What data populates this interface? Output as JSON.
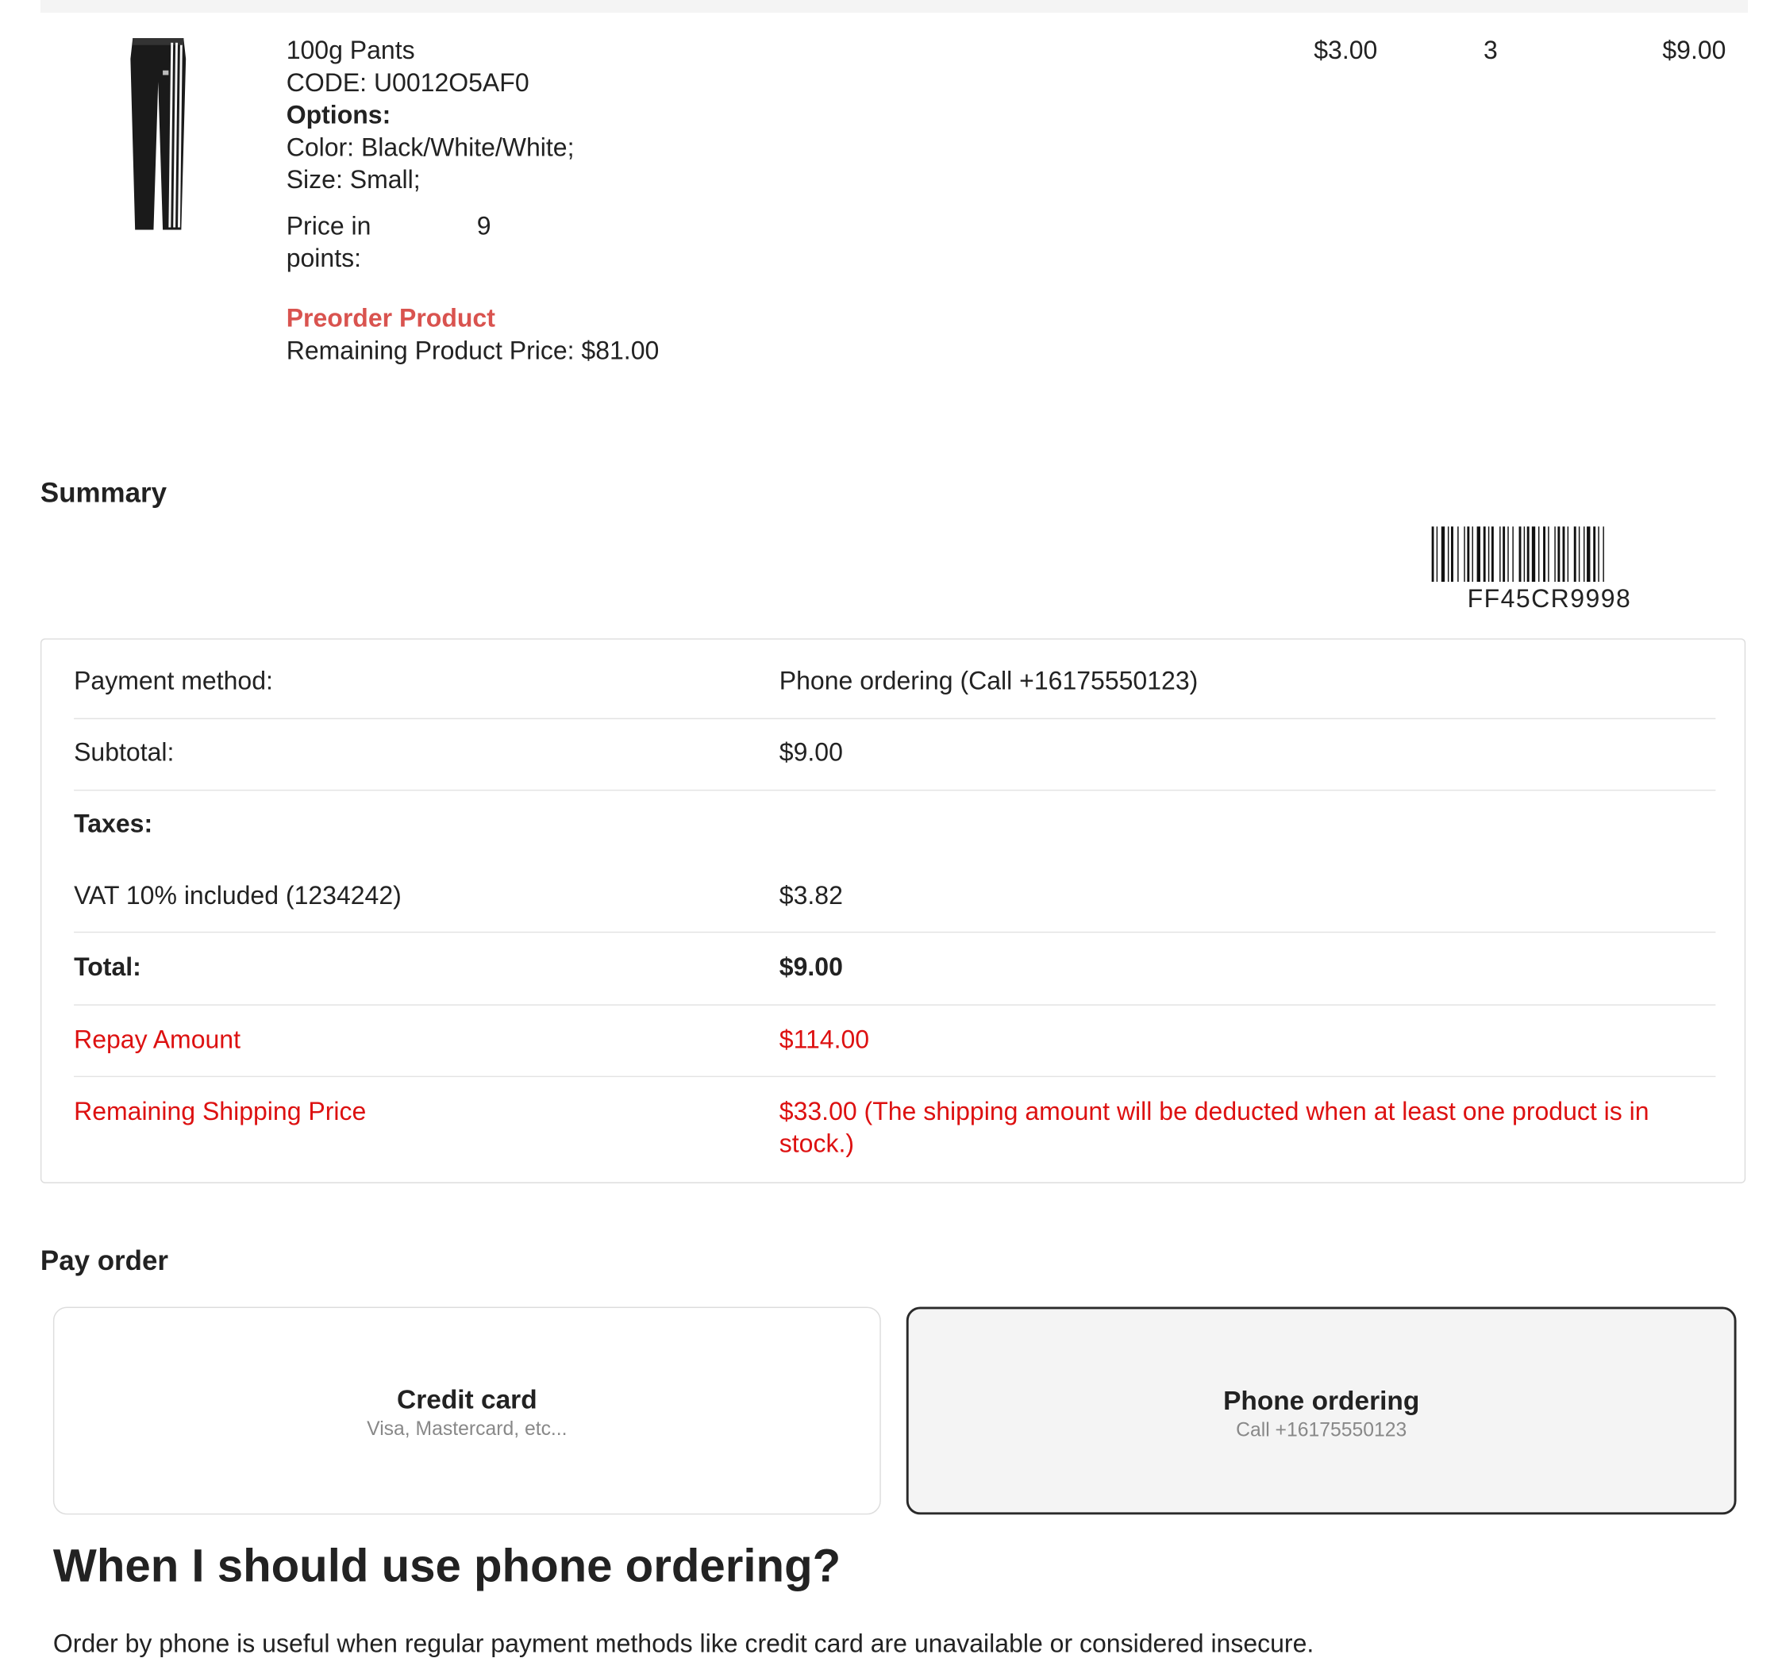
{
  "product": {
    "name": "100g Pants",
    "code_line": "CODE: U0012O5AF0",
    "options_label": "Options:",
    "option_color": "Color: Black/White/White;",
    "option_size": "Size: Small;",
    "points_label_1": "Price in",
    "points_label_2": "points:",
    "points_value": "9",
    "preorder_label": "Preorder Product",
    "remaining_price": "Remaining Product Price: $81.00",
    "unit_price": "$3.00",
    "quantity": "3",
    "line_total": "$9.00",
    "image_icon": "pants-image"
  },
  "summary": {
    "title": "Summary",
    "barcode_text": "FF45CR9998",
    "rows": {
      "payment_method": {
        "label": "Payment method:",
        "value": "Phone ordering (Call +16175550123)"
      },
      "subtotal": {
        "label": "Subtotal:",
        "value": "$9.00"
      },
      "taxes": {
        "label": "Taxes:"
      },
      "vat": {
        "label": "VAT 10% included (1234242)",
        "value": "$3.82"
      },
      "total": {
        "label": "Total:",
        "value": "$9.00"
      },
      "repay": {
        "label": "Repay Amount",
        "value": "$114.00"
      },
      "remaining_shipping": {
        "label": "Remaining Shipping Price",
        "value": "$33.00 (The shipping amount will be deducted when at least one product is in stock.)"
      }
    }
  },
  "pay_order": {
    "title": "Pay order",
    "methods": [
      {
        "title": "Credit card",
        "subtitle": "Visa, Mastercard, etc..."
      },
      {
        "title": "Phone ordering",
        "subtitle": "Call +16175550123"
      }
    ]
  },
  "faq": {
    "title": "When I should use phone ordering?",
    "text": "Order by phone is useful when regular payment methods like credit card are unavailable or considered insecure."
  },
  "colors": {
    "preorder": "#d9534f",
    "alert_red": "#dd1111",
    "selected_border": "#2a2a2a",
    "selected_bg": "#f4f4f4"
  }
}
